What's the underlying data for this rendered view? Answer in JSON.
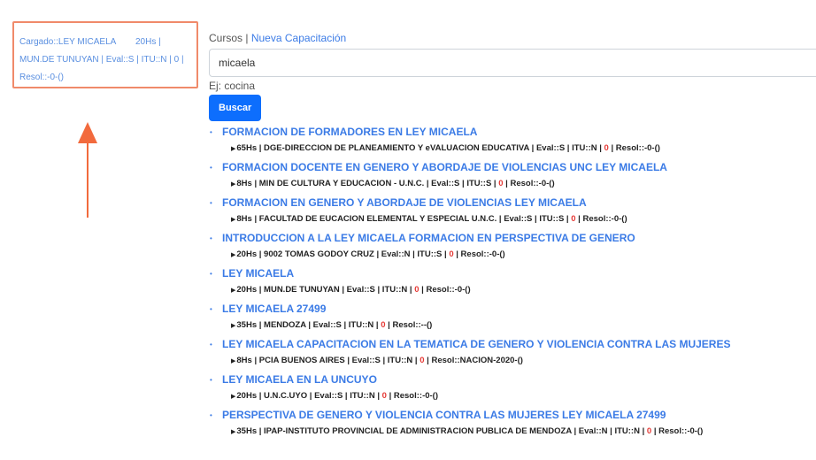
{
  "loaded_box": {
    "text": "Cargado::LEY MICAELA        20Hs |\nMUN.DE TUNUYAN | Eval::S | ITU::N | 0 |\nResol::-0-()"
  },
  "nav": {
    "cursos": "Cursos",
    "separator": "|",
    "nueva": "Nueva Capacitación"
  },
  "search": {
    "value": "micaela",
    "hint": "Ej: cocina",
    "button": "Buscar"
  },
  "colors": {
    "accent": "#3b7be6",
    "highlight_border": "#f08a6a",
    "arrow": "#f26a3d",
    "zero_red": "#e53935",
    "button": "#0d6efd"
  },
  "results": [
    {
      "title": "FORMACION DE FORMADORES EN LEY MICAELA",
      "hours": "65Hs",
      "body": " | DGE-DIRECCION DE PLANEAMIENTO Y eVALUACION EDUCATIVA | Eval::S | ITU::N | ",
      "zero": "0",
      "resol": " | Resol::-0-()"
    },
    {
      "title": "FORMACION DOCENTE EN GENERO Y ABORDAJE DE VIOLENCIAS UNC LEY MICAELA",
      "hours": "8Hs",
      "body": " | MIN DE CULTURA Y EDUCACION - U.N.C. | Eval::S | ITU::S | ",
      "zero": "0",
      "resol": " | Resol::-0-()"
    },
    {
      "title": "FORMACION EN GENERO Y ABORDAJE DE VIOLENCIAS LEY MICAELA",
      "hours": "8Hs",
      "body": " | FACULTAD DE EUCACION ELEMENTAL Y ESPECIAL U.N.C. | Eval::S | ITU::S | ",
      "zero": "0",
      "resol": " | Resol::-0-()"
    },
    {
      "title": "INTRODUCCION A LA LEY MICAELA FORMACION EN PERSPECTIVA DE GENERO",
      "hours": "20Hs",
      "body": " | 9002 TOMAS GODOY CRUZ | Eval::N | ITU::S | ",
      "zero": "0",
      "resol": " | Resol::-0-()"
    },
    {
      "title": "LEY MICAELA",
      "hours": "20Hs",
      "body": " | MUN.DE TUNUYAN | Eval::S | ITU::N | ",
      "zero": "0",
      "resol": " | Resol::-0-()"
    },
    {
      "title": "LEY MICAELA 27499",
      "hours": "35Hs",
      "body": " | MENDOZA | Eval::S | ITU::N | ",
      "zero": "0",
      "resol": " | Resol::--()"
    },
    {
      "title": "LEY MICAELA CAPACITACION EN LA TEMATICA DE GENERO Y VIOLENCIA CONTRA LAS MUJERES",
      "hours": "8Hs",
      "body": " | PCIA BUENOS AIRES | Eval::S | ITU::N | ",
      "zero": "0",
      "resol": " | Resol::NACION-2020-()"
    },
    {
      "title": "LEY MICAELA EN LA UNCUYO",
      "hours": "20Hs",
      "body": " | U.N.C.UYO | Eval::S | ITU::N | ",
      "zero": "0",
      "resol": " | Resol::-0-()"
    },
    {
      "title": "PERSPECTIVA DE GENERO Y VIOLENCIA CONTRA LAS MUJERES LEY MICAELA 27499",
      "hours": "35Hs",
      "body": " | IPAP-INSTITUTO PROVINCIAL DE ADMINISTRACION PUBLICA DE MENDOZA | Eval::N | ITU::N | ",
      "zero": "0",
      "resol": " | Resol::-0-()"
    }
  ]
}
